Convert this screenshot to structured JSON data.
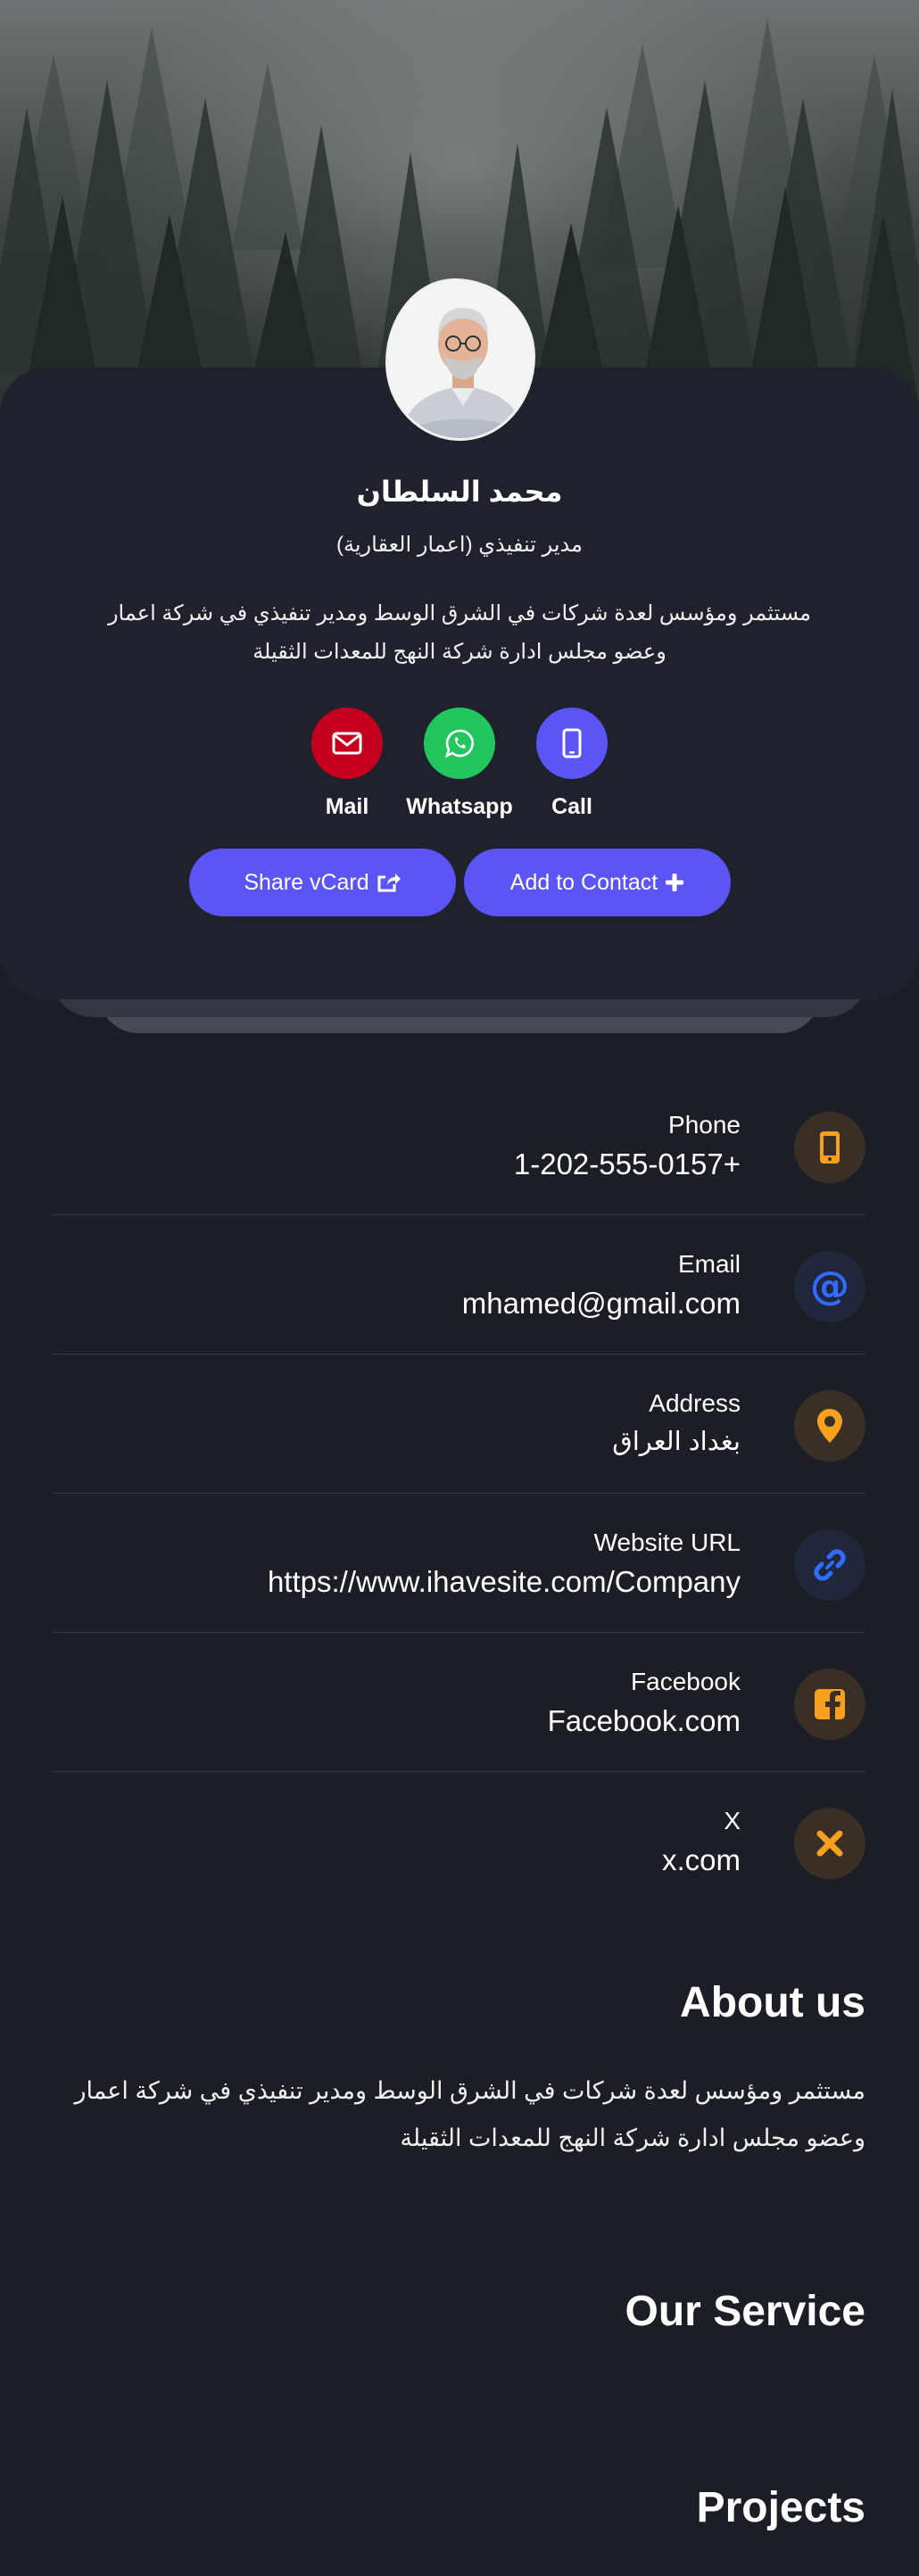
{
  "profile": {
    "name": "محمد السلطان",
    "title": "مدير تنفيذي (اعمار العقارية)",
    "bio": "مستثمر ومؤسس لعدة شركات في الشرق الوسط ومدير تنفيذي في شركة اعمار وعضو مجلس ادارة شركة النهج للمعدات الثقيلة"
  },
  "actions": [
    {
      "label": "Mail",
      "icon": "envelope-icon",
      "color": "#c4001e"
    },
    {
      "label": "Whatsapp",
      "icon": "whatsapp-icon",
      "color": "#22c55e"
    },
    {
      "label": "Call",
      "icon": "mobile-phone-icon",
      "color": "#5a55f4"
    }
  ],
  "buttons": {
    "share_vcard": "Share vCard",
    "add_contact": "Add to Contact"
  },
  "contacts": [
    {
      "label": "Phone",
      "value": "1-202-555-0157+",
      "icon": "mobile-phone-icon",
      "accent": "#f7a01d"
    },
    {
      "label": "Email",
      "value": "mhamed@gmail.com",
      "icon": "at-sign-icon",
      "accent": "#2f6cff"
    },
    {
      "label": "Address",
      "value": "بغداد العراق",
      "icon": "map-pin-icon",
      "accent": "#f7a01d"
    },
    {
      "label": "Website URL",
      "value": "https://www.ihavesite.com/Company",
      "icon": "link-icon",
      "accent": "#2f6cff"
    },
    {
      "label": "Facebook",
      "value": "Facebook.com",
      "icon": "facebook-icon",
      "accent": "#f7a01d"
    },
    {
      "label": "X",
      "value": "x.com",
      "icon": "x-icon",
      "accent": "#f7a01d"
    }
  ],
  "sections": {
    "about_title": "About us",
    "about_text": "مستثمر ومؤسس لعدة شركات في الشرق الوسط ومدير تنفيذي في شركة اعمار وعضو مجلس ادارة شركة النهج للمعدات الثقيلة",
    "service_title": "Our Service",
    "projects_title": "Projects"
  },
  "colors": {
    "accent_primary": "#5a55f4",
    "accent_orange": "#f7a01d",
    "accent_blue": "#2f6cff",
    "background": "#1b1e25",
    "card": "#1f222c"
  }
}
